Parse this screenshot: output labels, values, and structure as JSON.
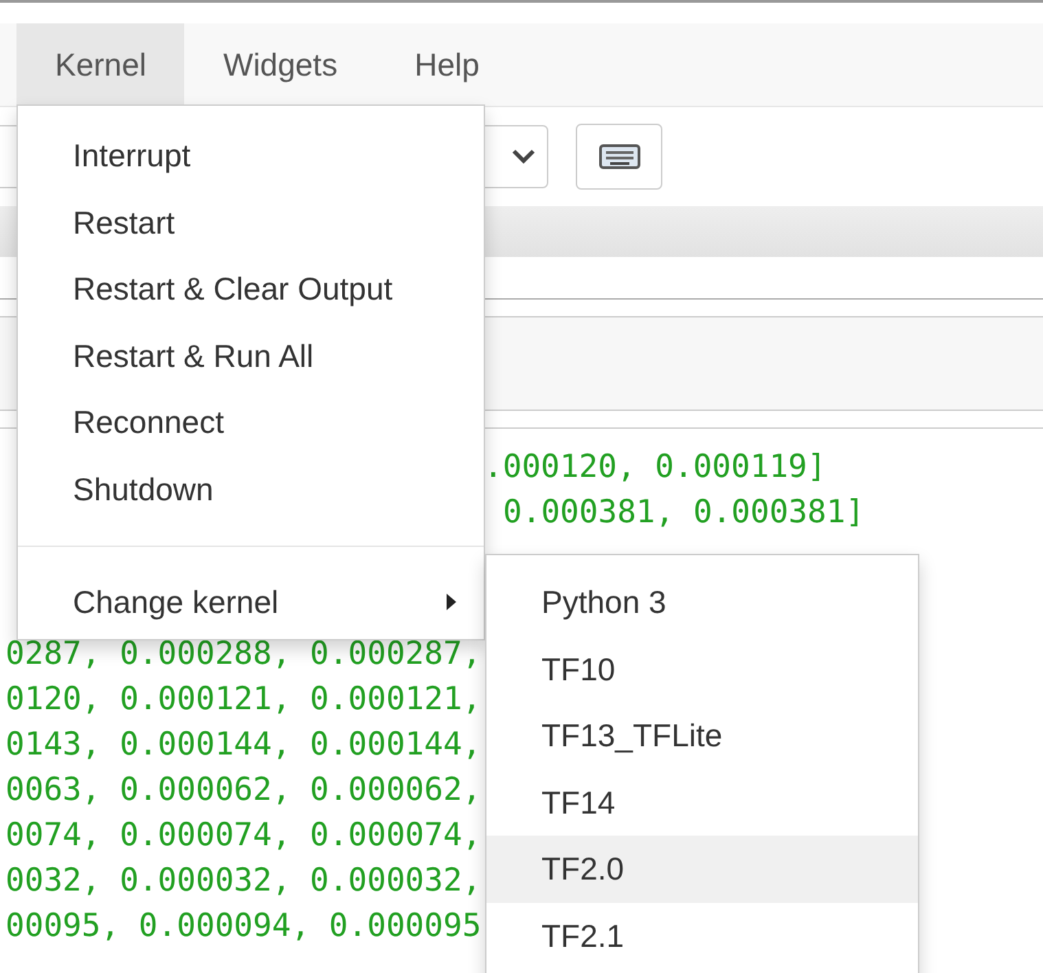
{
  "menubar": [
    {
      "label": "Kernel",
      "selected": true
    },
    {
      "label": "Widgets",
      "selected": false
    },
    {
      "label": "Help",
      "selected": false
    }
  ],
  "output_rows": [
    {
      "right": ".000120, 0.000119]"
    },
    {
      "right": "0.000381, 0.000381]"
    },
    {
      "left": "0287, 0.000288, 0.000287,"
    },
    {
      "left": "0120, 0.000121, 0.000121,"
    },
    {
      "left": "0143, 0.000144, 0.000144,"
    },
    {
      "left": "0063, 0.000062, 0.000062,"
    },
    {
      "left": "0074, 0.000074, 0.000074,"
    },
    {
      "left": "0032, 0.000032, 0.000032,"
    },
    {
      "left": "00095, 0.000094, 0.000095"
    }
  ],
  "kernel_menu": [
    {
      "kind": "item",
      "label": "Interrupt"
    },
    {
      "kind": "item",
      "label": "Restart"
    },
    {
      "kind": "item",
      "label": "Restart & Clear Output"
    },
    {
      "kind": "item",
      "label": "Restart & Run All"
    },
    {
      "kind": "item",
      "label": "Reconnect"
    },
    {
      "kind": "item",
      "label": "Shutdown"
    },
    {
      "kind": "divider"
    },
    {
      "kind": "submenu",
      "label": "Change kernel"
    }
  ],
  "change_kernel_menu": [
    {
      "label": "Python 3",
      "selected": false
    },
    {
      "label": "TF10",
      "selected": false
    },
    {
      "label": "TF13_TFLite",
      "selected": false
    },
    {
      "label": "TF14",
      "selected": false
    },
    {
      "label": "TF2.0",
      "selected": true
    },
    {
      "label": "TF2.1",
      "selected": false
    }
  ]
}
